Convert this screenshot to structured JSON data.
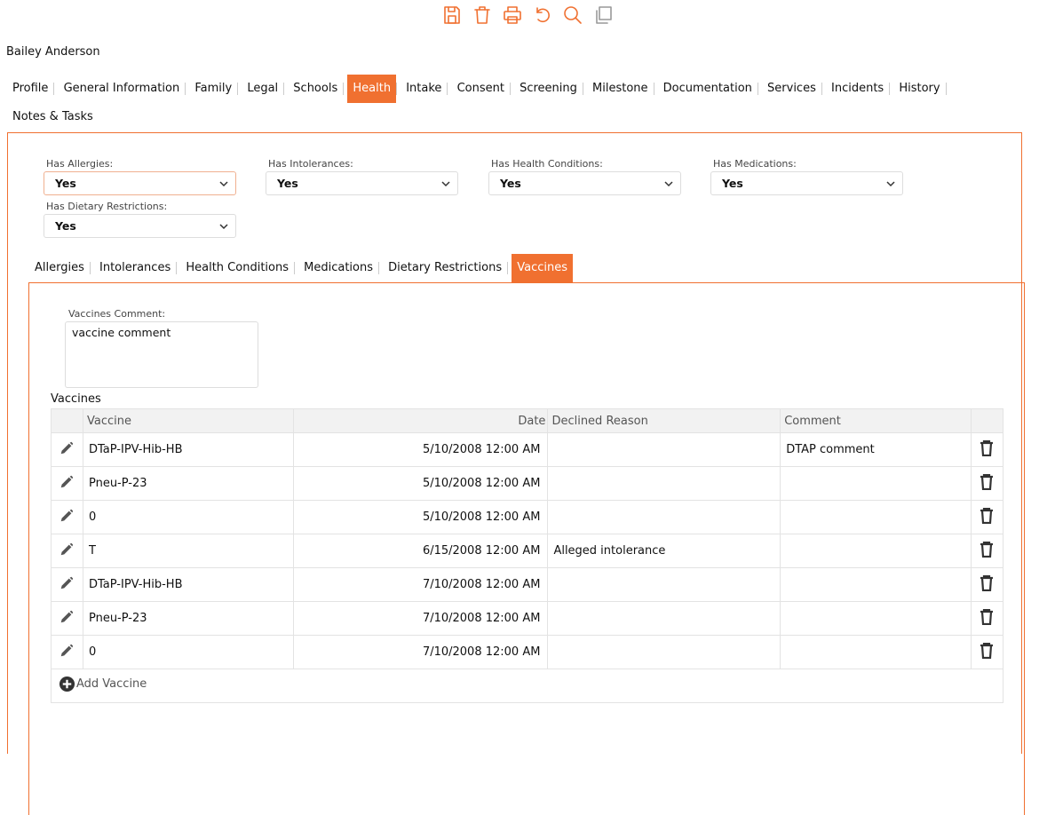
{
  "toolbar": {
    "icons": [
      "save-icon",
      "delete-icon",
      "print-icon",
      "undo-icon",
      "search-icon",
      "copy-icon"
    ],
    "accent": "#f07030"
  },
  "client": {
    "name": "Bailey Anderson"
  },
  "main_tabs": [
    "Profile",
    "General Information",
    "Family",
    "Legal",
    "Schools",
    "Health",
    "Intake",
    "Consent",
    "Screening",
    "Milestone",
    "Documentation",
    "Services",
    "Incidents",
    "History",
    "Notes & Tasks"
  ],
  "main_tabs_active": "Health",
  "health": {
    "has_allergies": {
      "label": "Has Allergies:",
      "value": "Yes"
    },
    "has_intolerances": {
      "label": "Has Intolerances:",
      "value": "Yes"
    },
    "has_health_conditions": {
      "label": "Has Health Conditions:",
      "value": "Yes"
    },
    "has_medications": {
      "label": "Has Medications:",
      "value": "Yes"
    },
    "has_dietary_restrictions": {
      "label": "Has Dietary Restrictions:",
      "value": "Yes"
    }
  },
  "sub_tabs": [
    "Allergies",
    "Intolerances",
    "Health Conditions",
    "Medications",
    "Dietary Restrictions",
    "Vaccines"
  ],
  "sub_tabs_active": "Vaccines",
  "vaccines": {
    "comment_label": "Vaccines Comment:",
    "comment_value": "vaccine comment",
    "grid_title": "Vaccines",
    "columns": [
      "Vaccine",
      "Date",
      "Declined Reason",
      "Comment"
    ],
    "rows": [
      {
        "vaccine": "DTaP-IPV-Hib-HB",
        "date": "5/10/2008 12:00 AM",
        "declined_reason": "",
        "comment": "DTAP comment"
      },
      {
        "vaccine": "Pneu-P-23",
        "date": "5/10/2008 12:00 AM",
        "declined_reason": "",
        "comment": ""
      },
      {
        "vaccine": "0",
        "date": "5/10/2008 12:00 AM",
        "declined_reason": "",
        "comment": ""
      },
      {
        "vaccine": "T",
        "date": "6/15/2008 12:00 AM",
        "declined_reason": "Alleged intolerance",
        "comment": ""
      },
      {
        "vaccine": "DTaP-IPV-Hib-HB",
        "date": "7/10/2008 12:00 AM",
        "declined_reason": "",
        "comment": ""
      },
      {
        "vaccine": "Pneu-P-23",
        "date": "7/10/2008 12:00 AM",
        "declined_reason": "",
        "comment": ""
      },
      {
        "vaccine": "0",
        "date": "7/10/2008 12:00 AM",
        "declined_reason": "",
        "comment": ""
      }
    ],
    "add_label": "Add Vaccine"
  }
}
